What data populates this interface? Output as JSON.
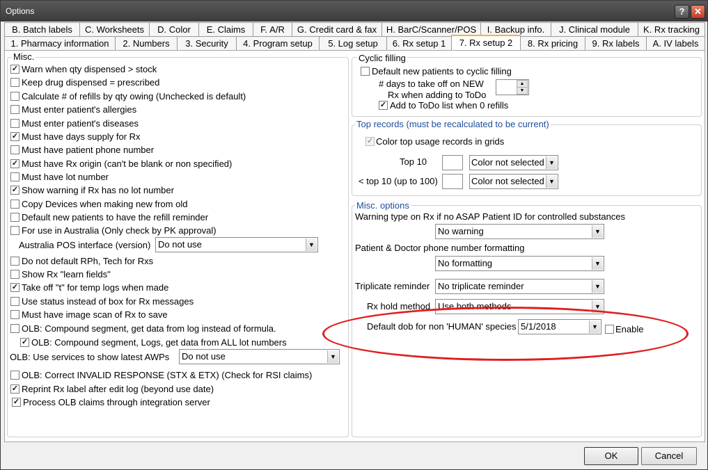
{
  "window": {
    "title": "Options",
    "help": "?",
    "close": "✕"
  },
  "tabs_row1": [
    "B. Batch labels",
    "C. Worksheets",
    "D. Color",
    "E. Claims",
    "F. A/R",
    "G. Credit card & fax",
    "H. BarC/Scanner/POS",
    "I. Backup info.",
    "J. Clinical module",
    "K. Rx tracking"
  ],
  "tabs_row2": [
    "1. Pharmacy information",
    "2. Numbers",
    "3. Security",
    "4. Program setup",
    "5. Log setup",
    "6. Rx setup 1",
    "7. Rx setup 2",
    "8. Rx pricing",
    "9. Rx labels",
    "A. IV labels"
  ],
  "misc": {
    "title": "Misc.",
    "items": [
      {
        "label": "Warn when qty dispensed > stock",
        "checked": "✓"
      },
      {
        "label": "Keep drug dispensed = prescribed",
        "checked": ""
      },
      {
        "label": "Calculate # of refills by qty owing (Unchecked is default)",
        "checked": ""
      },
      {
        "label": "Must enter patient's allergies",
        "checked": ""
      },
      {
        "label": "Must enter patient's diseases",
        "checked": ""
      },
      {
        "label": "Must have days supply for Rx",
        "checked": "✓"
      },
      {
        "label": "Must have patient phone number",
        "checked": ""
      },
      {
        "label": "Must have Rx origin (can't be blank or non specified)",
        "checked": "✓"
      },
      {
        "label": "Must have lot number",
        "checked": ""
      },
      {
        "label": "Show warning if Rx has no lot number",
        "checked": "✓"
      },
      {
        "label": "Copy Devices when making new from old",
        "checked": ""
      },
      {
        "label": "Default new patients to have the refill reminder",
        "checked": ""
      },
      {
        "label": "For use in Australia (Only check by PK approval)",
        "checked": ""
      }
    ],
    "australia_label": "Australia POS interface (version)",
    "australia_value": "Do not use",
    "items2": [
      {
        "label": "Do not default RPh, Tech for Rxs",
        "checked": ""
      },
      {
        "label": "Show Rx \"learn fields\"",
        "checked": ""
      },
      {
        "label": "Take off \"t\" for temp logs when made",
        "checked": "✓"
      },
      {
        "label": "Use status instead of box for Rx messages",
        "checked": ""
      },
      {
        "label": "Must have image scan of Rx to save",
        "checked": ""
      },
      {
        "label": "OLB: Compound segment, get data from log instead of formula.",
        "checked": ""
      },
      {
        "label": "OLB: Compound segment, Logs, get data from ALL lot numbers",
        "checked": "✓"
      }
    ],
    "awp_label": "OLB:  Use services to show latest AWPs",
    "awp_value": "Do not use",
    "items3": [
      {
        "label": "OLB: Correct INVALID RESPONSE (STX & ETX)  (Check for RSI claims)",
        "checked": ""
      },
      {
        "label": "Reprint Rx label after edit log (beyond use date)",
        "checked": "✓"
      },
      {
        "label": "Process OLB claims through integration server",
        "checked": "✓"
      }
    ]
  },
  "cyclic": {
    "title": "Cyclic filling",
    "default_label": "Default new patients to cyclic filling",
    "default_checked": "",
    "days_label1": "# days to take off on NEW",
    "days_label2": "Rx when adding to ToDo",
    "todo_label": "Add to ToDo list when 0 refills",
    "todo_checked": "✓"
  },
  "top": {
    "title": "Top records (must be recalculated to be current)",
    "color_label": "Color top usage records in grids",
    "color_checked": "✓",
    "top10_label": "Top 10",
    "top10_value": "Color not selected",
    "top100_label": "< top 10 (up to 100)",
    "top100_value": "Color not selected"
  },
  "miscopt": {
    "title": "Misc. options",
    "warning_label": "Warning type on Rx if no ASAP Patient ID for controlled substances",
    "warning_value": "No warning",
    "phone_label": "Patient & Doctor phone number formatting",
    "phone_value": "No formatting",
    "trip_label": "Triplicate reminder",
    "trip_value": "No triplicate reminder",
    "hold_label": "Rx hold method",
    "hold_value": "Use both methods",
    "dob_label": "Default dob for non 'HUMAN' species",
    "dob_value": "5/1/2018",
    "enable_label": "Enable",
    "enable_checked": ""
  },
  "buttons": {
    "ok": "OK",
    "cancel": "Cancel"
  }
}
